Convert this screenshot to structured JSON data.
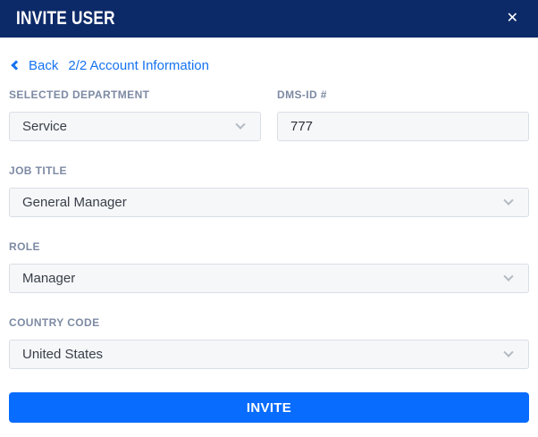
{
  "modal": {
    "title": "INVITE USER",
    "close_icon": "✕"
  },
  "nav": {
    "back_label": "Back",
    "step_label": "2/2 Account Information"
  },
  "form": {
    "fields": [
      {
        "label": "SELECTED DEPARTMENT",
        "value": "Service",
        "type": "select"
      },
      {
        "label": "DMS-ID #",
        "value": "777",
        "type": "text"
      },
      {
        "label": "JOB TITLE",
        "value": "General Manager",
        "type": "select"
      },
      {
        "label": "ROLE",
        "value": "Manager",
        "type": "select"
      },
      {
        "label": "COUNTRY CODE",
        "value": "United States",
        "type": "select"
      }
    ],
    "submit_label": "INVITE"
  },
  "colors": {
    "header_bg": "#0d2a68",
    "link_blue": "#1673f0",
    "label_gray": "#7d8aa3",
    "field_bg": "#f6f7f9",
    "field_border": "#d9dee5",
    "field_text": "#393f49",
    "chevron_gray": "#b4bac3",
    "accent_blue": "#086cfe"
  }
}
